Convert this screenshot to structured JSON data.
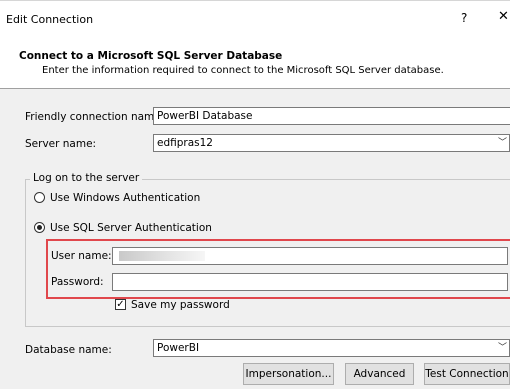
{
  "window": {
    "title": "Edit Connection",
    "help_glyph": "?",
    "close_glyph": "✕"
  },
  "header": {
    "title": "Connect to a Microsoft SQL Server Database",
    "subtitle": "Enter the information required to connect to the Microsoft SQL Server database."
  },
  "form": {
    "friendly_label": "Friendly connection name:",
    "friendly_value": "PowerBI Database",
    "server_label": "Server name:",
    "server_value": "edfipras12",
    "logon_group_label": "Log on to the server",
    "windows_auth_label": "Use Windows Authentication",
    "sql_auth_label": "Use SQL Server Authentication",
    "selected_auth": "sql",
    "username_label": "User name:",
    "username_value": "",
    "password_label": "Password:",
    "password_value": "",
    "save_password_label": "Save my password",
    "save_password_checked": true,
    "database_label": "Database name:",
    "database_value": "PowerBI"
  },
  "buttons": {
    "impersonation": "Impersonation...",
    "advanced": "Advanced",
    "test_connection": "Test Connection"
  },
  "icons": {
    "dropdown": "chevron-down-icon",
    "check": "checkmark-icon"
  },
  "colors": {
    "highlight_border": "#e0474c"
  }
}
